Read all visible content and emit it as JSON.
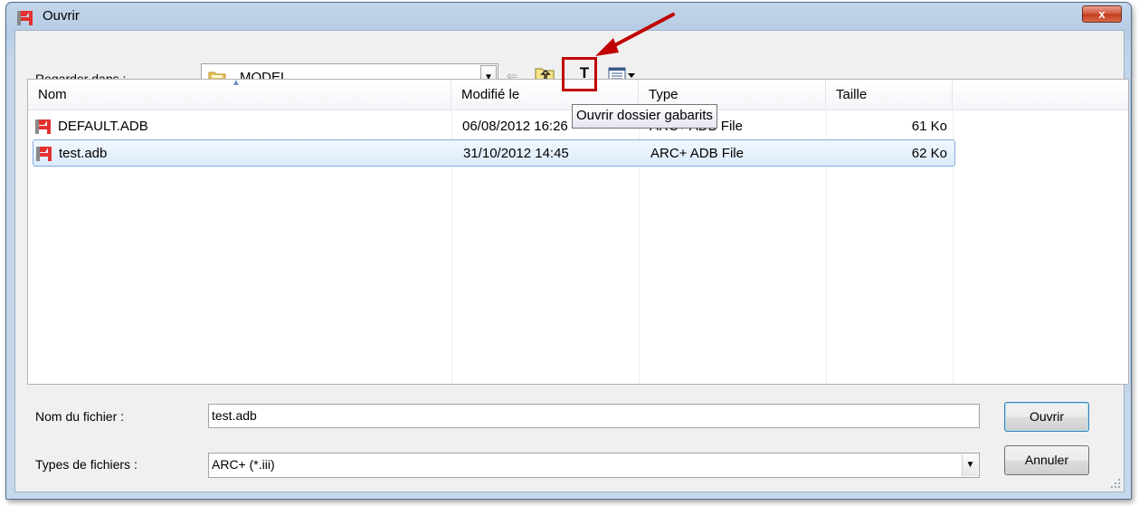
{
  "window": {
    "title": "Ouvrir",
    "close_label": "x"
  },
  "toolbar": {
    "look_in_label": "Regarder dans :",
    "look_in_value": "MODEL",
    "back_glyph": "⇐",
    "templates_button_label": "T",
    "tooltip": "Ouvrir dossier gabarits"
  },
  "list": {
    "columns": [
      "Nom",
      "Modifié le",
      "Type",
      "Taille"
    ],
    "rows": [
      {
        "name": "DEFAULT.ADB",
        "modified": "06/08/2012 16:26",
        "type": "ARC+ ADB File",
        "size": "61 Ko"
      },
      {
        "name": "test.adb",
        "modified": "31/10/2012 14:45",
        "type": "ARC+ ADB File",
        "size": "62 Ko"
      }
    ]
  },
  "footer": {
    "filename_label": "Nom du fichier :",
    "filename_value": "test.adb",
    "filetype_label": "Types de fichiers :",
    "filetype_value": "ARC+ (*.iii)",
    "open_label": "Ouvrir",
    "cancel_label": "Annuler"
  },
  "colors": {
    "accent_red": "#c00000",
    "selection_border": "#84acdd"
  }
}
